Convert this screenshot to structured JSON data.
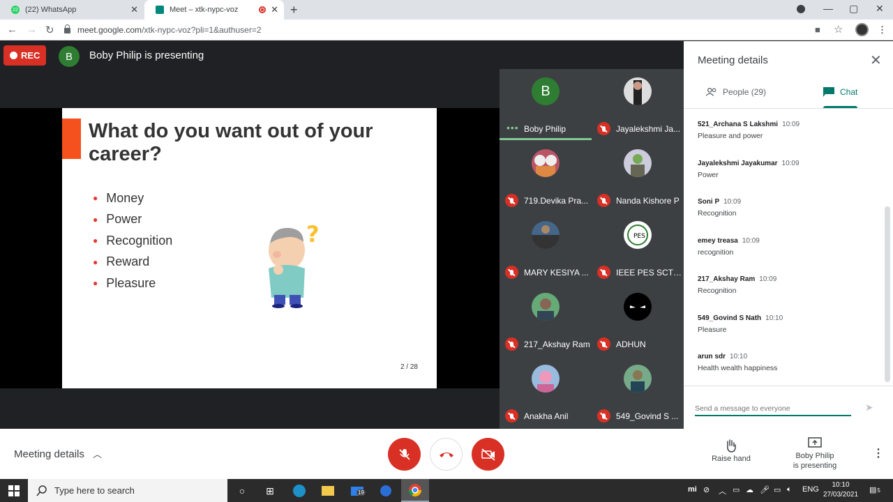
{
  "browser": {
    "tabs": [
      {
        "label": "(22) WhatsApp",
        "badge": "22"
      },
      {
        "label": "Meet – xtk-nypc-voz"
      }
    ],
    "url_host": "meet.google.com",
    "url_path": "/xtk-nypc-voz?pli=1&authuser=2"
  },
  "header": {
    "rec_label": "REC",
    "presenter_initial": "B",
    "presenting_text": "Boby Philip is presenting"
  },
  "slide": {
    "title": "What do you want out of your career?",
    "bullets": [
      "Money",
      "Power",
      "Recognition",
      "Reward",
      "Pleasure"
    ],
    "page": "2 / 28"
  },
  "participants": [
    {
      "name": "Boby Philip",
      "initial": "B"
    },
    {
      "name": "Jayalekshmi Ja..."
    },
    {
      "name": "719.Devika Pra..."
    },
    {
      "name": "Nanda Kishore P"
    },
    {
      "name": "MARY KESIYA ..."
    },
    {
      "name": "IEEE PES SCTSB",
      "logo_text": "PES"
    },
    {
      "name": "217_Akshay Ram"
    },
    {
      "name": "ADHUN"
    },
    {
      "name": "Anakha Anil"
    },
    {
      "name": "549_Govind S ..."
    }
  ],
  "panel": {
    "title": "Meeting details",
    "people_tab": "People (29)",
    "chat_tab": "Chat",
    "messages": [
      {
        "sender": "521_Archana S Lakshmi",
        "time": "10:09",
        "text": "Pleasure and power"
      },
      {
        "sender": "Jayalekshmi Jayakumar",
        "time": "10:09",
        "text": "Power"
      },
      {
        "sender": "Soni P",
        "time": "10:09",
        "text": "Recognition"
      },
      {
        "sender": "emey treasa",
        "time": "10:09",
        "text": "recognition"
      },
      {
        "sender": "217_Akshay Ram",
        "time": "10:09",
        "text": "Recognition"
      },
      {
        "sender": "549_Govind S Nath",
        "time": "10:10",
        "text": "Pleasure"
      },
      {
        "sender": "arun sdr",
        "time": "10:10",
        "text": "Health wealth happiness"
      }
    ],
    "compose_placeholder": "Send a message to everyone"
  },
  "bottombar": {
    "meeting_details": "Meeting details",
    "raise_hand": "Raise hand",
    "presenting_line1": "Boby Philip",
    "presenting_line2": "is presenting"
  },
  "taskbar": {
    "search_placeholder": "Type here to search",
    "mail_badge": "19",
    "lang": "ENG",
    "time": "10:10",
    "date": "27/03/2021",
    "notif_count": "5"
  },
  "colors": {
    "meet_green": "#00796b",
    "rec_red": "#d93025",
    "slide_accent": "#f4511e"
  }
}
